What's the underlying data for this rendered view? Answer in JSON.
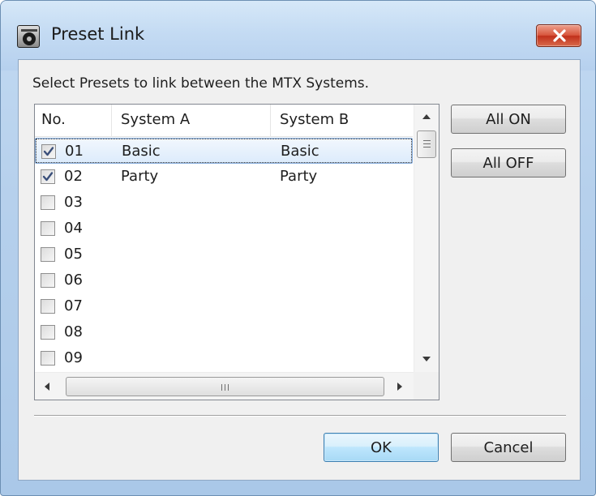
{
  "window": {
    "title": "Preset Link",
    "icon": "yamaha-app-icon",
    "close_icon": "close-icon"
  },
  "instruction": "Select Presets to link between the MTX Systems.",
  "list": {
    "columns": [
      "No.",
      "System A",
      "System B"
    ],
    "rows": [
      {
        "checked": true,
        "no": "01",
        "system_a": "Basic",
        "system_b": "Basic",
        "selected": true
      },
      {
        "checked": true,
        "no": "02",
        "system_a": "Party",
        "system_b": "Party",
        "selected": false
      },
      {
        "checked": false,
        "no": "03",
        "system_a": "",
        "system_b": "",
        "selected": false
      },
      {
        "checked": false,
        "no": "04",
        "system_a": "",
        "system_b": "",
        "selected": false
      },
      {
        "checked": false,
        "no": "05",
        "system_a": "",
        "system_b": "",
        "selected": false
      },
      {
        "checked": false,
        "no": "06",
        "system_a": "",
        "system_b": "",
        "selected": false
      },
      {
        "checked": false,
        "no": "07",
        "system_a": "",
        "system_b": "",
        "selected": false
      },
      {
        "checked": false,
        "no": "08",
        "system_a": "",
        "system_b": "",
        "selected": false
      },
      {
        "checked": false,
        "no": "09",
        "system_a": "",
        "system_b": "",
        "selected": false
      }
    ]
  },
  "buttons": {
    "all_on": "All ON",
    "all_off": "All OFF",
    "ok": "OK",
    "cancel": "Cancel"
  },
  "colors": {
    "accent": "#3c7fb1",
    "selection": "#dcebfc",
    "close": "#c1301b"
  }
}
